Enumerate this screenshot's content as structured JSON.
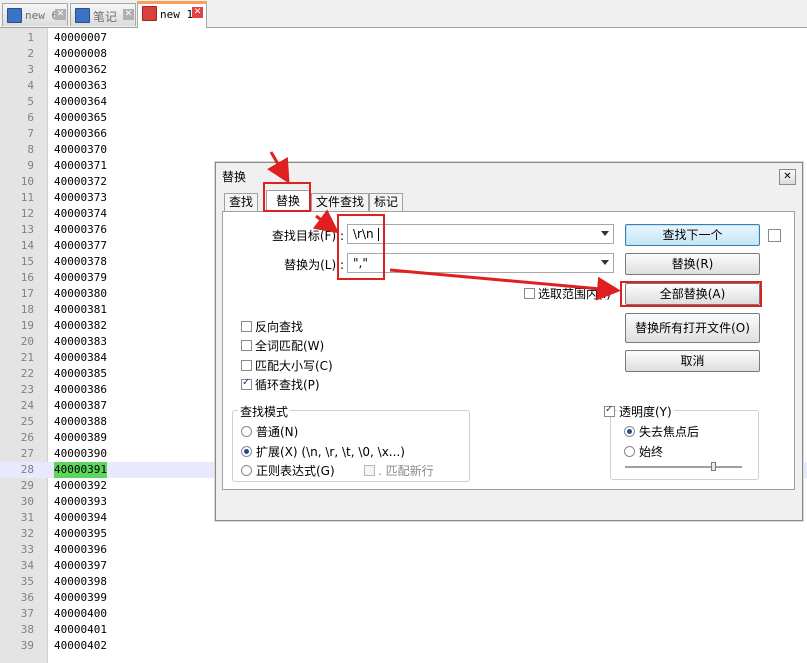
{
  "file_tabs": [
    {
      "name": "new 6",
      "icon": "save-icon-blue",
      "active": false
    },
    {
      "name": "笔记",
      "icon": "save-icon-blue",
      "active": false
    },
    {
      "name": "new 1",
      "icon": "save-icon-red",
      "active": true
    }
  ],
  "editor": {
    "current_line": 28,
    "lines": [
      {
        "n": "1",
        "t": "40000007"
      },
      {
        "n": "2",
        "t": "40000008"
      },
      {
        "n": "3",
        "t": "40000362"
      },
      {
        "n": "4",
        "t": "40000363"
      },
      {
        "n": "5",
        "t": "40000364"
      },
      {
        "n": "6",
        "t": "40000365"
      },
      {
        "n": "7",
        "t": "40000366"
      },
      {
        "n": "8",
        "t": "40000370"
      },
      {
        "n": "9",
        "t": "40000371"
      },
      {
        "n": "10",
        "t": "40000372"
      },
      {
        "n": "11",
        "t": "40000373"
      },
      {
        "n": "12",
        "t": "40000374"
      },
      {
        "n": "13",
        "t": "40000376"
      },
      {
        "n": "14",
        "t": "40000377"
      },
      {
        "n": "15",
        "t": "40000378"
      },
      {
        "n": "16",
        "t": "40000379"
      },
      {
        "n": "17",
        "t": "40000380"
      },
      {
        "n": "18",
        "t": "40000381"
      },
      {
        "n": "19",
        "t": "40000382"
      },
      {
        "n": "20",
        "t": "40000383"
      },
      {
        "n": "21",
        "t": "40000384"
      },
      {
        "n": "22",
        "t": "40000385"
      },
      {
        "n": "23",
        "t": "40000386"
      },
      {
        "n": "24",
        "t": "40000387"
      },
      {
        "n": "25",
        "t": "40000388"
      },
      {
        "n": "26",
        "t": "40000389"
      },
      {
        "n": "27",
        "t": "40000390"
      },
      {
        "n": "28",
        "t": "40000391"
      },
      {
        "n": "29",
        "t": "40000392"
      },
      {
        "n": "30",
        "t": "40000393"
      },
      {
        "n": "31",
        "t": "40000394"
      },
      {
        "n": "32",
        "t": "40000395"
      },
      {
        "n": "33",
        "t": "40000396"
      },
      {
        "n": "34",
        "t": "40000397"
      },
      {
        "n": "35",
        "t": "40000398"
      },
      {
        "n": "36",
        "t": "40000399"
      },
      {
        "n": "37",
        "t": "40000400"
      },
      {
        "n": "38",
        "t": "40000401"
      },
      {
        "n": "39",
        "t": "40000402"
      }
    ]
  },
  "dialog": {
    "title": "替换",
    "close_glyph": "✕",
    "tabs": [
      "查找",
      "替换",
      "文件查找",
      "标记"
    ],
    "active_tab": 1,
    "find_label": "查找目标(F) :",
    "find_value": "\\r\\n",
    "replace_label": "替换为(L) :",
    "replace_value": "\",\"",
    "in_selection_label": "选取范围内(I)",
    "buttons": {
      "find_next": "查找下一个",
      "replace": "替换(R)",
      "replace_all": "全部替换(A)",
      "replace_all_open": "替换所有打开文件(O)",
      "cancel": "取消"
    },
    "options": {
      "backward": {
        "label": "反向查找",
        "checked": false
      },
      "whole_word": {
        "label": "全词匹配(W)",
        "checked": false
      },
      "match_case": {
        "label": "匹配大小写(C)",
        "checked": false
      },
      "wrap": {
        "label": "循环查找(P)",
        "checked": true
      }
    },
    "search_mode": {
      "title": "查找模式",
      "normal": "普通(N)",
      "extended": "扩展(X) (\\n, \\r, \\t, \\0, \\x...)",
      "regex": "正则表达式(G)",
      "dot_newline": ". 匹配新行",
      "selected": "extended"
    },
    "transparency": {
      "label": "透明度(Y)",
      "checked": true,
      "on_lose_focus": "失去焦点后",
      "always": "始终",
      "selected": "on_lose_focus",
      "level": 0.75
    }
  },
  "colors": {
    "annotation": "#e02020",
    "current_line": "#5cd65c"
  }
}
